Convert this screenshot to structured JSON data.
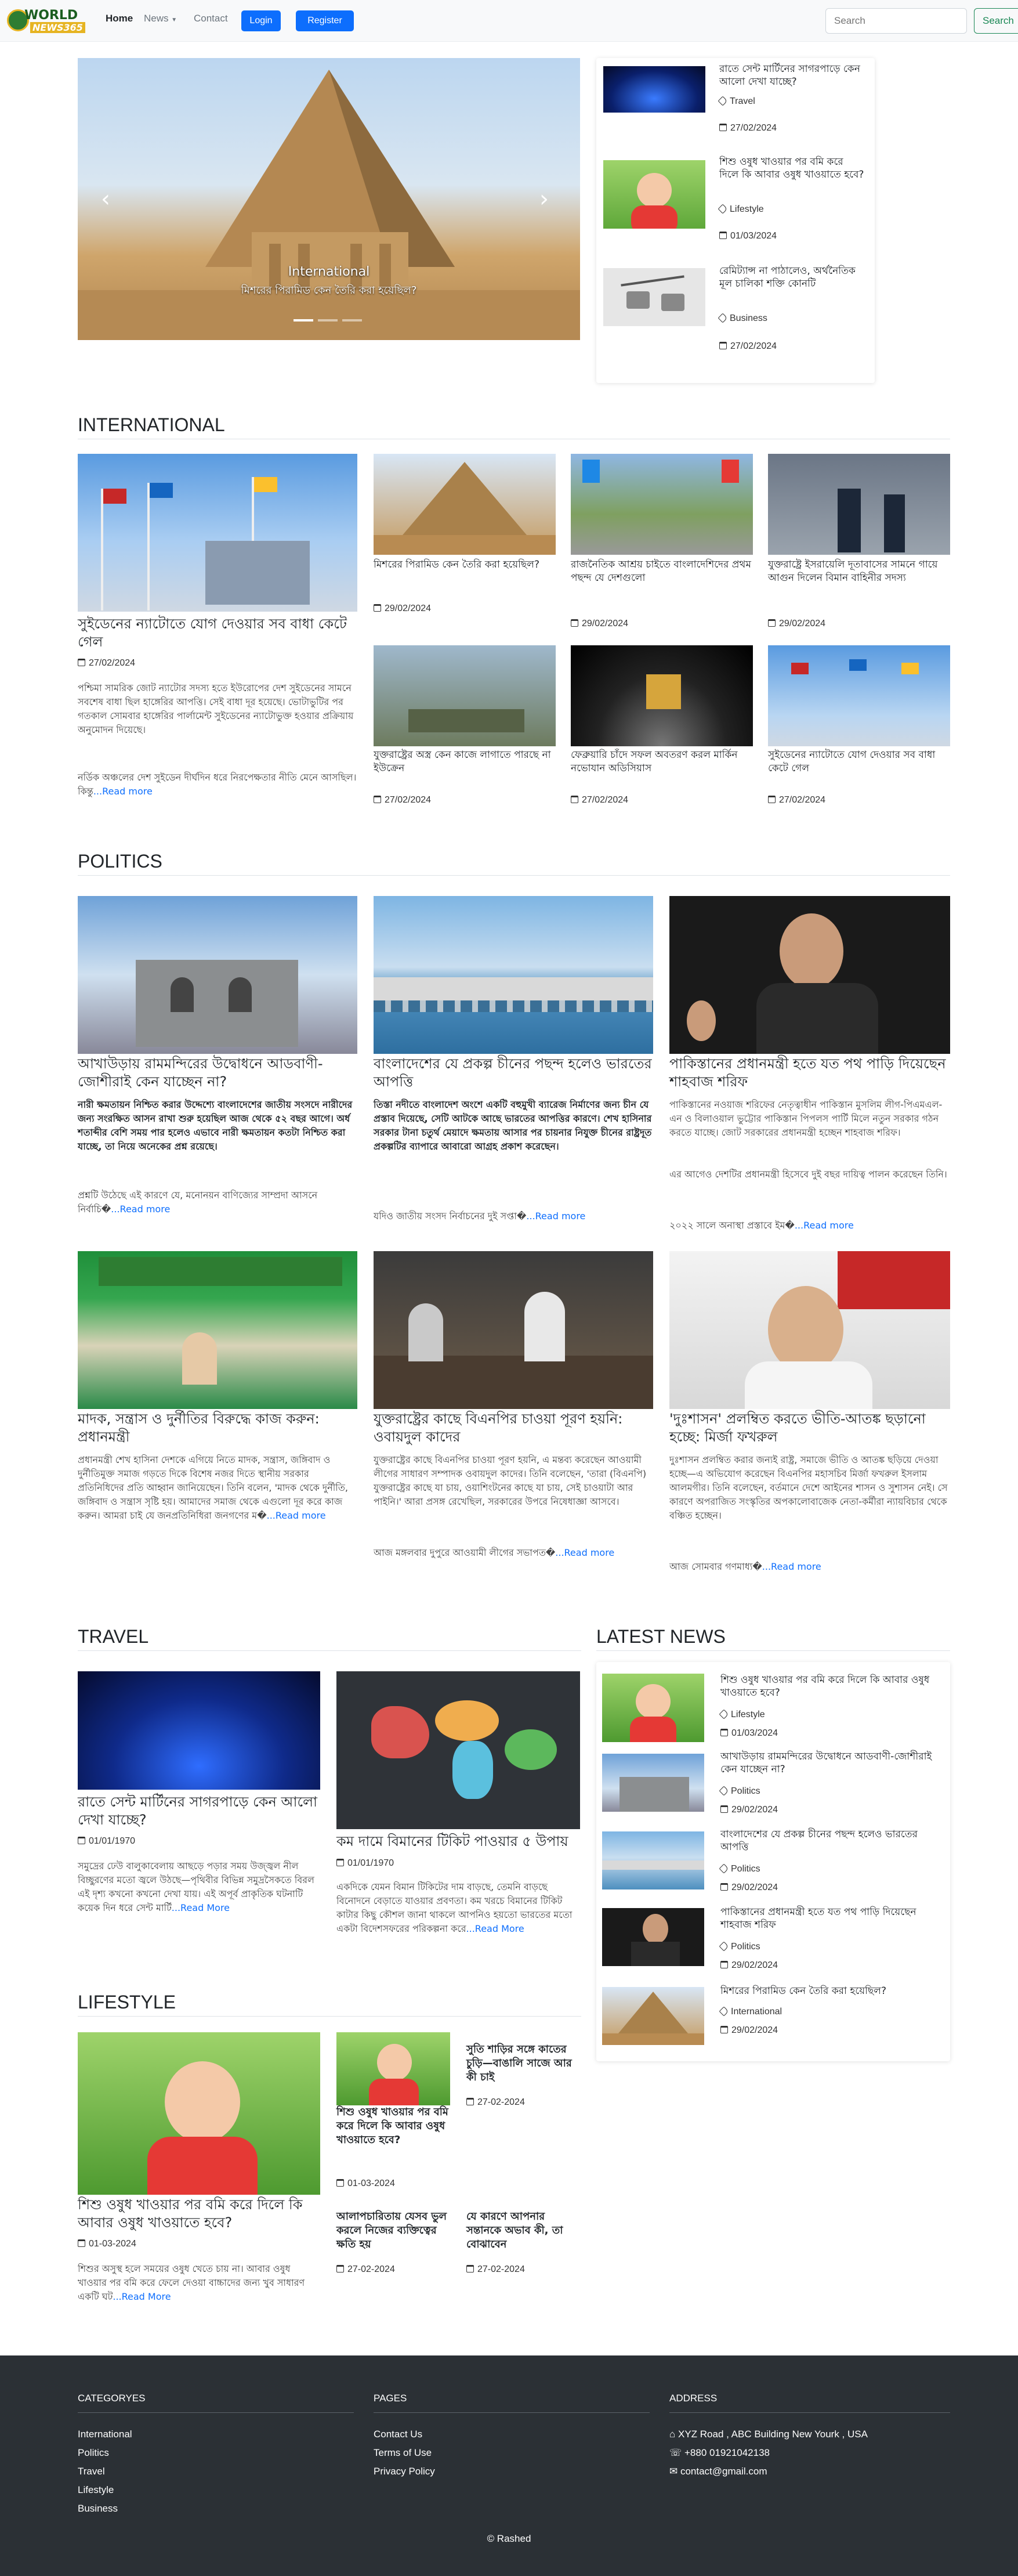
{
  "brand": {
    "logo_word1": "WORLD",
    "logo_word2": "NEWS365"
  },
  "nav": {
    "home": "Home",
    "news": "News",
    "contact": "Contact",
    "login": "Login",
    "register": "Register",
    "search_placeholder": "Search",
    "search_button": "Search"
  },
  "hero": {
    "slide_category": "International",
    "slide_title": "মিশরের পিরামিড কেন তৈরি করা হয়েছিল?"
  },
  "side_list": [
    {
      "title": "রাতে সেন্ট মার্টিনের সাগরপাড়ে কেন আলো দেখা যাচ্ছে?",
      "cat": "Travel",
      "date": "27/02/2024"
    },
    {
      "title": "শিশু ওষুধ খাওয়ার পর বমি করে দিলে কি আবার ওষুধ খাওয়াতে হবে?",
      "cat": "Lifestyle",
      "date": "01/03/2024"
    },
    {
      "title": "রেমিট্যান্স না পাঠালেও, অর্থনৈতিক মূল চালিকা শক্তি কোনটি",
      "cat": "Business",
      "date": "27/02/2024"
    }
  ],
  "international": {
    "heading": "INTERNATIONAL",
    "main": {
      "title": "সুইডেনের ন্যাটোতে যোগ দেওয়ার সব বাধা কেটে গেল",
      "date": "27/02/2024",
      "p1": "পশ্চিমা সামরিক জোট ন্যাটোর সদস্য হতে ইউরোপের দেশ সুইডেনের সামনে সবশেষ বাধা ছিল হাঙ্গেরির আপত্তি। সেই বাধা দূর হয়েছে। ভোটাভুটির পর গতকাল সোমবার হাঙ্গেরির পার্লামেন্ট সুইডেনের ন্যাটোভুক্ত হওয়ার প্রক্রিয়ায় অনুমোদন দিয়েছে।",
      "p2": "নর্ডিক অঞ্চলের দেশ সুইডেন দীর্ঘদিন ধরে নিরপেক্ষতার নীতি মেনে আসছিল। কিন্তু",
      "more": "...Read more"
    },
    "items": [
      {
        "title": "মিশরের পিরামিড কেন তৈরি করা হয়েছিল?",
        "date": "29/02/2024"
      },
      {
        "title": "রাজনৈতিক আশ্রয় চাইতে বাংলাদেশিদের প্রথম পছন্দ যে দেশগুলো",
        "date": "29/02/2024"
      },
      {
        "title": "যুক্তরাষ্ট্রে ইসরায়েলি দূতাবাসের সামনে গায়ে আগুন দিলেন বিমান বাহিনীর সদস্য",
        "date": "29/02/2024"
      },
      {
        "title": "যুক্তরাষ্ট্রের অস্ত্র কেন কাজে লাগাতে পারছে না ইউক্রেন",
        "date": "27/02/2024"
      },
      {
        "title": "ফেব্রুয়ারি চাঁদে সফল অবতরণ করল মার্কিন নভোযান অডিসিয়াস",
        "date": "27/02/2024"
      },
      {
        "title": "সুইডেনের ন্যাটোতে যোগ দেওয়ার সব বাধা কেটে গেল",
        "date": "27/02/2024"
      }
    ]
  },
  "politics": {
    "heading": "POLITICS",
    "items": [
      {
        "title": "আখাউড়ায় রামমন্দিরের উদ্বোধনে আডবাণী-জোশীরাই কেন যাচ্ছেন না?",
        "lead": "নারী ক্ষমতায়ন নিশ্চিত করার উদ্দেশ্যে বাংলাদেশের জাতীয় সংসদে নারীদের জন্য সংরক্ষিত আসন রাখা শুরু হয়েছিল আজ থেকে ৫২ বছর আগে। অর্ধ শতাব্দীর বেশি সময় পার হলেও এভাবে নারী ক্ষমতায়ন কতটা নিশ্চিত করা যাচ্ছে, তা নিয়ে অনেকের প্রশ্ন রয়েছে।",
        "tail": "প্রশ্নটি উঠেছে এই কারণে যে, মনোনয়ন বাণিজ্যের সাম্প্রদা আসনে নির্বাচি�",
        "more": "...Read more"
      },
      {
        "title": "বাংলাদেশের যে প্রকল্প চীনের পছন্দ হলেও ভারতের আপত্তি",
        "lead": "তিস্তা নদীতে বাংলাদেশ অংশে একটি বহুমুখী ব্যারেজ নির্মাণের জন্য চীন যে প্রস্তাব দিয়েছে, সেটি আটকে আছে ভারতের আপত্তির কারণে। শেখ হাসিনার সরকার টানা চতুর্থ মেয়াদে ক্ষমতায় আসার পর চায়নার নিযুক্ত চীনের রাষ্ট্রদূত প্রকল্পটির ব্যাপারে আবারো আগ্রহ প্রকাশ করেছেন।",
        "tail": "যদিও জাতীয় সংসদ নির্বাচনের দুই সপ্তা�",
        "more": "...Read more"
      },
      {
        "title": "পাকিস্তানের প্রধানমন্ত্রী হতে যত পথ পাড়ি দিয়েছেন শাহবাজ শরিফ",
        "lead": "পাকিস্তানের নওয়াজ শরিফের নেতৃত্বাধীন পাকিস্তান মুসলিম লীগ-পিএমএল-এন ও বিলাওয়াল ভুট্টোর পাকিস্তান পিপলস পার্টি মিলে নতুন সরকার গঠন করতে যাচ্ছে। জোট সরকারের প্রধানমন্ত্রী হচ্ছেন শাহবাজ শরিফ।",
        "tail": "এর আগেও দেশটির প্রধানমন্ত্রী হিসেবে দুই বছর দায়িত্ব পালন করেছেন তিনি।",
        "tail2": "২০২২ সালে অনাস্থা প্রস্তাবে ইম�",
        "more": "...Read more"
      },
      {
        "title": "মাদক, সন্ত্রাস ও দুর্নীতির বিরুদ্ধে কাজ করুন: প্রধানমন্ত্রী",
        "lead": "প্রধানমন্ত্রী শেখ হাসিনা দেশকে এগিয়ে নিতে মাদক, সন্ত্রাস, জঙ্গিবাদ ও দুর্নীতিমুক্ত সমাজ গড়তে দিকে বিশেষ নজর দিতে স্থানীয় সরকার প্রতিনিধিদের প্রতি আহ্বান জানিয়েছেন। তিনি বলেন, 'মাদক থেকে দুর্নীতি, জঙ্গিবাদ ও সন্ত্রাস সৃষ্টি হয়। আমাদের সমাজ থেকে এগুলো দূর করে কাজ করুন। আমরা চাই যে জনপ্রতিনিধিরা জনগণের ম�",
        "more": "...Read more"
      },
      {
        "title": "যুক্তরাষ্ট্রের কাছে বিএনপির চাওয়া পূরণ হয়নি: ওবায়দুল কাদের",
        "lead": "যুক্তরাষ্ট্রের কাছে বিএনপির চাওয়া পূরণ হয়নি, এ মন্তব্য করেছেন আওয়ামী লীগের সাধারণ সম্পাদক ওবায়দুল কাদের। তিনি বলেছেন, 'তারা (বিএনপি) যুক্তরাষ্ট্রের কাছে যা চায়, ওয়াশিংটনের কাছে যা চায়, সেই চাওয়াটা আর পাইনি।' আরা প্রসঙ্গ রেখেছিল, সরকারের উপরে নিষেধাজ্ঞা আসবে।",
        "tail": "আজ মঙ্গলবার দুপুরে আওয়ামী লীগের সভাপত�",
        "more": "...Read more"
      },
      {
        "title": "'দুঃশাসন' প্রলম্বিত করতে ভীতি-আতঙ্ক ছড়ানো হচ্ছে: মির্জা ফখরুল",
        "lead": "দুঃশাসন প্রলম্বিত করার জন্যই রাষ্ট্র, সমাজে ভীতি ও আতঙ্ক ছড়িয়ে দেওয়া হচ্ছে—এ অভিযোগ করেছেন বিএনপির মহাসচিব মির্জা ফখরুল ইসলাম আলমগীর। তিনি বলেছেন, বর্তমানে দেশে আইনের শাসন ও সুশাসন নেই। সে কারণে অপরাজিত সংস্কৃতির অপকালোবাজেক নেতা-কর্মীরা ন্যায়বিচার থেকে বঞ্চিত হচ্ছেন।",
        "tail": "আজ সোমবার গণমাধ্য�",
        "more": "...Read more"
      }
    ]
  },
  "travel": {
    "heading": "TRAVEL",
    "items": [
      {
        "title": "রাতে সেন্ট মার্টিনের সাগরপাড়ে কেন আলো দেখা যাচ্ছে?",
        "date": "01/01/1970",
        "lead": "সমুদ্রের ঢেউ বালুকাবেলায় আছড়ে পড়ার সময় উজ্জ্বল নীল বিচ্ছুরণের মতো জ্বলে উঠছে—পৃথিবীর বিভিন্ন সমুদ্রসৈকতে বিরল এই দৃশ্য কখনো কখনো দেখা যায়। এই অপূর্ব প্রাকৃতিক ঘটনাটি কয়েক দিন ধরে সেন্ট মার্টি",
        "more": "...Read More"
      },
      {
        "title": "কম দামে বিমানের টিকিট পাওয়ার ৫ উপায়",
        "date": "01/01/1970",
        "lead": "একদিকে যেমন বিমান টিকিটের দাম বাড়ছে, তেমনি বাড়ছে বিনোদনে বেড়াতে যাওয়ার প্রবণতা। কম খরচে বিমানের টিকিট কাটার কিছু কৌশল জানা থাকলে আপনিও হয়তো ভারতের মতো একটা বিদেশসফরের পরিকল্পনা করে",
        "more": "...Read More"
      }
    ]
  },
  "lifestyle": {
    "heading": "LIFESTYLE",
    "main": {
      "title": "শিশু ওষুধ খাওয়ার পর বমি করে দিলে কি আবার ওষুধ খাওয়াতে হবে?",
      "date": "01-03-2024",
      "lead": "শিশুর অসুস্থ হলে সময়ের ওষুধ খেতে চায় না। আবার ওষুধ খাওয়ার পর বমি করে ফেলে দেওয়া বাচ্চাদের জন্য খুব সাধারণ একটি ঘট",
      "more": "...Read More"
    },
    "items": [
      {
        "title": "শিশু ওষুধ খাওয়ার পর বমি করে দিলে কি আবার ওষুধ খাওয়াতে হবে?",
        "date": "01-03-2024"
      },
      {
        "title": "সুতি শাড়ির সঙ্গে কাতের চুড়ি—বাঙালি সাজে আর কী চাই",
        "date": "27-02-2024"
      },
      {
        "title": "আলাপচারিতায় যেসব ভুল করলে নিজের ব্যক্তিত্বের ক্ষতি হয়",
        "date": "27-02-2024"
      },
      {
        "title": "যে কারণে আপনার সন্তানকে অভাব কী, তা বোঝাবেন",
        "date": "27-02-2024"
      }
    ]
  },
  "latest": {
    "heading": "LATEST NEWS",
    "items": [
      {
        "title": "শিশু ওষুধ খাওয়ার পর বমি করে দিলে কি আবার ওষুধ খাওয়াতে হবে?",
        "cat": "Lifestyle",
        "date": "01/03/2024"
      },
      {
        "title": "আখাউড়ায় রামমন্দিরের উদ্বোধনে আডবাণী-জোশীরাই কেন যাচ্ছেন না?",
        "cat": "Politics",
        "date": "29/02/2024"
      },
      {
        "title": "বাংলাদেশের যে প্রকল্প চীনের পছন্দ হলেও ভারতের আপত্তি",
        "cat": "Politics",
        "date": "29/02/2024"
      },
      {
        "title": "পাকিস্তানের প্রধানমন্ত্রী হতে যত পথ পাড়ি দিয়েছেন শাহবাজ শরিফ",
        "cat": "Politics",
        "date": "29/02/2024"
      },
      {
        "title": "মিশরের পিরামিড কেন তৈরি করা হয়েছিল?",
        "cat": "International",
        "date": "29/02/2024"
      }
    ]
  },
  "footer": {
    "categories_heading": "CATEGORYES",
    "categories": [
      "International",
      "Politics",
      "Travel",
      "Lifestyle",
      "Business"
    ],
    "pages_heading": "PAGES",
    "pages": [
      "Contact Us",
      "Terms of Use",
      "Privacy Policy"
    ],
    "address_heading": "ADDRESS",
    "address": "XYZ Road , ABC Building New Yourk , USA",
    "phone": "+880 01921042138",
    "email": "contact@gmail.com",
    "copyright": "© Rashed"
  },
  "colors": {
    "primary": "#0d6efd",
    "success": "#198754",
    "footer_bg": "#2b3035"
  }
}
